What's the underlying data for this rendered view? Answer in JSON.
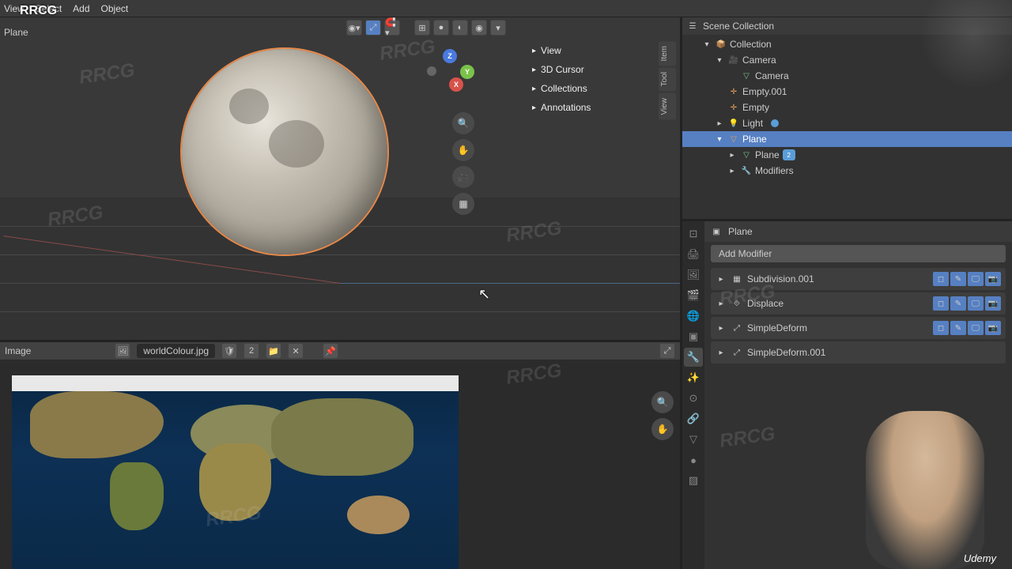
{
  "watermark": "RRCG",
  "logo": "RRCG",
  "udemy_label": "Udemy",
  "header_menus": [
    "View",
    "Select",
    "Add",
    "Object"
  ],
  "viewport": {
    "active_object": "Plane",
    "npanel": [
      "View",
      "3D Cursor",
      "Collections",
      "Annotations"
    ],
    "side_tabs": [
      "Item",
      "Tool",
      "View"
    ]
  },
  "outliner": {
    "title": "Scene Collection",
    "tree": [
      {
        "label": "Collection",
        "indent": 1,
        "icon": "📦",
        "exp": "▾"
      },
      {
        "label": "Camera",
        "indent": 2,
        "icon": "🎥",
        "exp": "▾",
        "color": "#e8a05a"
      },
      {
        "label": "Camera",
        "indent": 3,
        "icon": "▽",
        "exp": "",
        "color": "#7ac28a"
      },
      {
        "label": "Empty.001",
        "indent": 2,
        "icon": "✛",
        "exp": "",
        "color": "#e8a05a"
      },
      {
        "label": "Empty",
        "indent": 2,
        "icon": "✛",
        "exp": "",
        "color": "#e8a05a"
      },
      {
        "label": "Light",
        "indent": 2,
        "icon": "💡",
        "exp": "▸",
        "color": "#e8a05a",
        "dot": true
      },
      {
        "label": "Plane",
        "indent": 2,
        "icon": "▽",
        "exp": "▾",
        "sel": true,
        "color": "#e8a05a"
      },
      {
        "label": "Plane",
        "indent": 3,
        "icon": "▽",
        "exp": "▸",
        "color": "#7ac28a",
        "badge": "2"
      },
      {
        "label": "Modifiers",
        "indent": 3,
        "icon": "🔧",
        "exp": "▸",
        "color": "#5a9dd8"
      }
    ]
  },
  "properties": {
    "context_label": "Plane",
    "add_modifier": "Add Modifier",
    "modifiers": [
      {
        "name": "Subdivision.001",
        "icon": "▦",
        "btns": true
      },
      {
        "name": "Displace",
        "icon": "⟐",
        "btns": true
      },
      {
        "name": "SimpleDeform",
        "icon": "⤢",
        "btns": true
      },
      {
        "name": "SimpleDeform.001",
        "icon": "⤢",
        "btns": false
      }
    ]
  },
  "image_editor": {
    "label_left": "Image",
    "filename": "worldColour.jpg"
  }
}
